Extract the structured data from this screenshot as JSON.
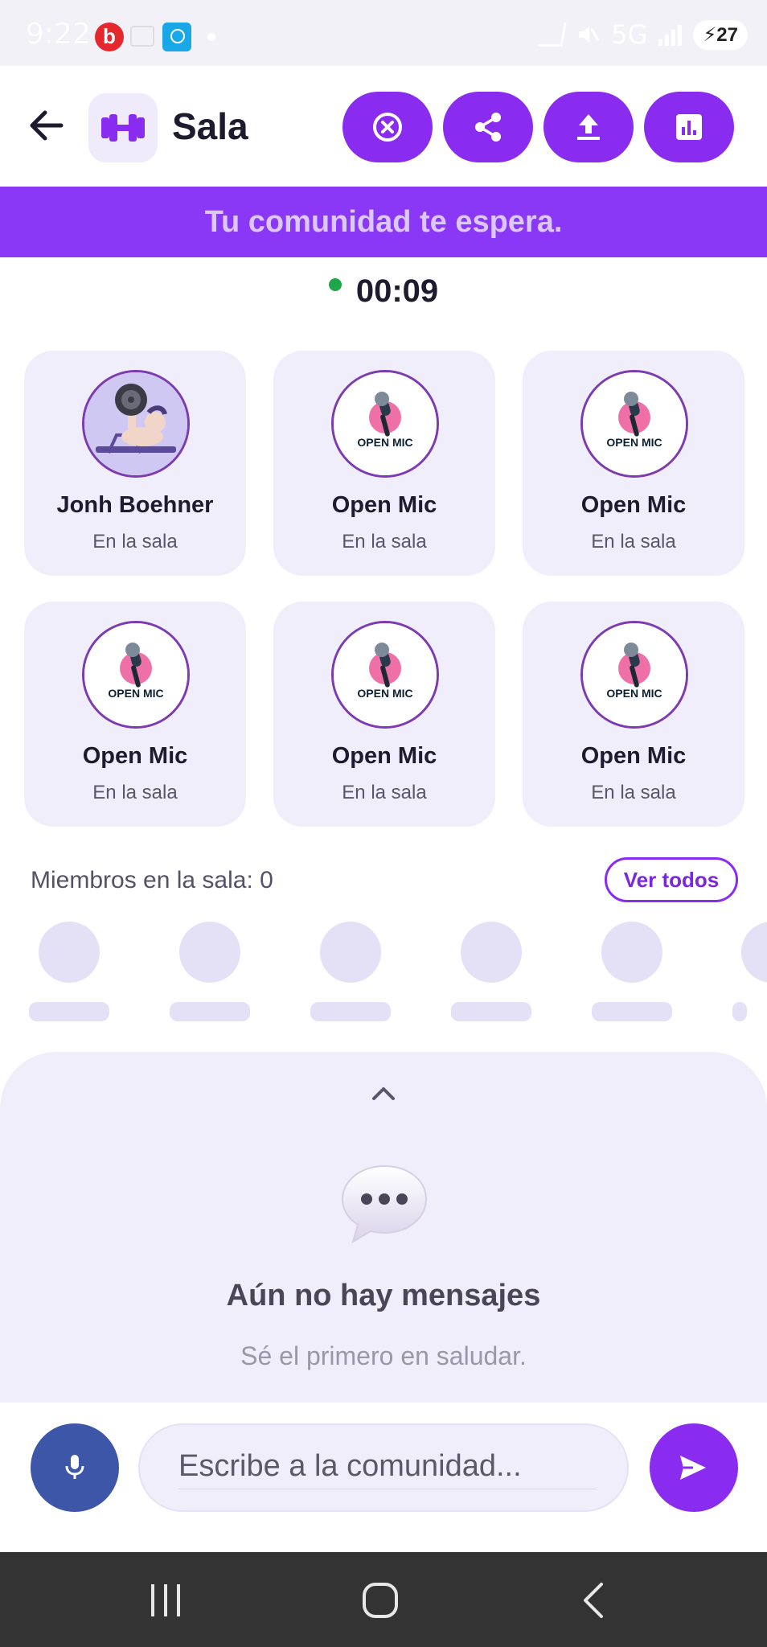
{
  "status_bar": {
    "time": "9:22",
    "network": "5G",
    "battery": "27",
    "icons": [
      "beats-app-icon",
      "mail-icon",
      "camera-app-icon",
      "notification-dot",
      "nfc-icon",
      "mute-icon",
      "signal-icon",
      "battery-charging-icon"
    ]
  },
  "header": {
    "title": "Sala",
    "room_icon": "dumbbell-icon",
    "actions": [
      "close-circle-icon",
      "share-icon",
      "upload-icon",
      "bar-chart-icon"
    ]
  },
  "banner": {
    "text": "Tu comunidad te espera."
  },
  "timer": {
    "value": "00:09"
  },
  "participants": [
    {
      "name": "Jonh Boehner",
      "status": "En la sala",
      "avatar": "weightlifter-avatar"
    },
    {
      "name": "Open Mic",
      "status": "En la sala",
      "avatar": "open-mic-logo",
      "logo_text": "OPEN MIC"
    },
    {
      "name": "Open Mic",
      "status": "En la sala",
      "avatar": "open-mic-logo",
      "logo_text": "OPEN MIC"
    },
    {
      "name": "Open Mic",
      "status": "En la sala",
      "avatar": "open-mic-logo",
      "logo_text": "OPEN MIC"
    },
    {
      "name": "Open Mic",
      "status": "En la sala",
      "avatar": "open-mic-logo",
      "logo_text": "OPEN MIC"
    },
    {
      "name": "Open Mic",
      "status": "En la sala",
      "avatar": "open-mic-logo",
      "logo_text": "OPEN MIC"
    }
  ],
  "members": {
    "label": "Miembros en la sala: 0",
    "see_all": "Ver todos"
  },
  "chat": {
    "empty_title": "Aún no hay mensajes",
    "empty_subtitle": "Sé el primero en saludar."
  },
  "composer": {
    "placeholder": "Escribe a la comunidad..."
  },
  "colors": {
    "accent": "#8a2cf0",
    "banner": "#8a38f5",
    "card_bg": "#f1eefc",
    "mic_button": "#3e56a8",
    "live_dot": "#1ea64b"
  }
}
